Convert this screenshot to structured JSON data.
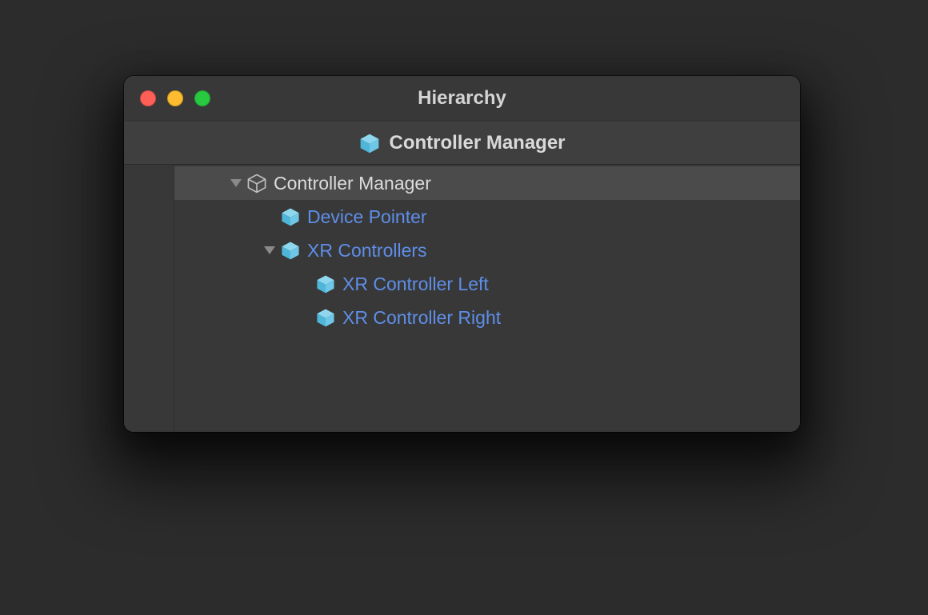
{
  "window": {
    "title": "Hierarchy"
  },
  "header": {
    "label": "Controller Manager"
  },
  "tree": {
    "root": {
      "label": "Controller Manager"
    },
    "items": [
      {
        "label": "Device Pointer"
      },
      {
        "label": "XR Controllers"
      },
      {
        "label": "XR Controller Left"
      },
      {
        "label": "XR Controller Right"
      }
    ]
  },
  "colors": {
    "prefab": "#5e8ee8",
    "icon_fill": "#6ec7e6",
    "icon_outline": "#b8b8b8"
  }
}
